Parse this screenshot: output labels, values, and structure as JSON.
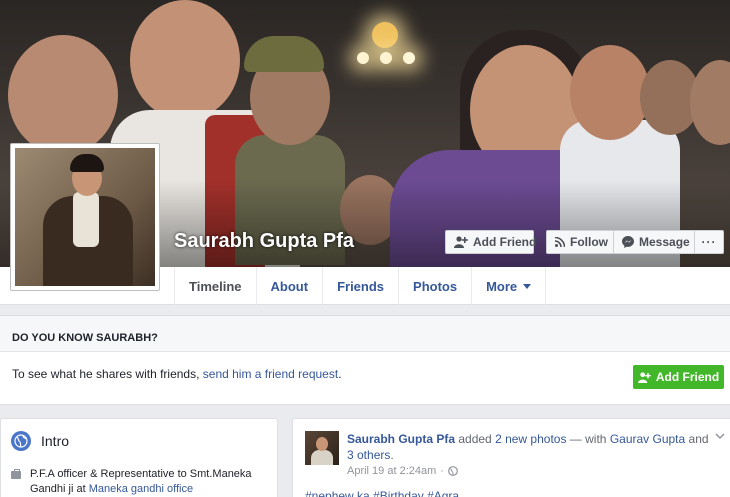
{
  "profile": {
    "name": "Saurabh Gupta Pfa"
  },
  "cover_buttons": {
    "add_friend": "Add Friend",
    "follow": "Follow",
    "message": "Message",
    "more": "···"
  },
  "nav": {
    "tabs": [
      {
        "label": "Timeline",
        "active": true
      },
      {
        "label": "About"
      },
      {
        "label": "Friends"
      },
      {
        "label": "Photos"
      },
      {
        "label": "More"
      }
    ]
  },
  "know_box": {
    "heading": "DO YOU KNOW SAURABH?",
    "text_prefix": "To see what he shares with friends, ",
    "link": "send him a friend request",
    "text_suffix": ".",
    "button": "Add Friend"
  },
  "intro": {
    "title": "Intro",
    "item_text": "P.F.A officer & Representative to Smt.Maneka Gandhi ji at ",
    "item_link": "Maneka gandhi office"
  },
  "post": {
    "author": "Saurabh Gupta Pfa",
    "added": " added ",
    "photos_link": "2 new photos",
    "with": " — with ",
    "with_name": "Gaurav Gupta",
    "and": " and ",
    "others_link": "3 others",
    "end": ".",
    "timestamp": "April 19 at 2:24am",
    "separator": "·",
    "tags": "#nephew ka #Birthday #Agra"
  },
  "colors": {
    "link": "#365899",
    "green_button": "#42b72a",
    "page_bg": "#e9ebee"
  }
}
